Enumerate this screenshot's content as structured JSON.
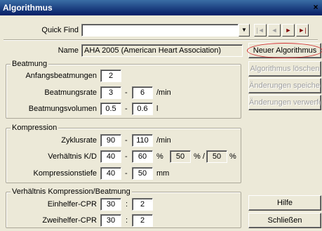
{
  "window": {
    "title": "Algorithmus",
    "close_glyph": "×"
  },
  "quick_find": {
    "label": "Quick Find",
    "value": ""
  },
  "nav": {
    "first": "|◄",
    "prev": "◄",
    "next": "►",
    "last": "►|"
  },
  "name": {
    "label": "Name",
    "value": "AHA 2005 (American Heart Association)"
  },
  "beatmung": {
    "title": "Beatmung",
    "anfangsbeatmungen": {
      "label": "Anfangsbeatmungen",
      "value": "2"
    },
    "beatmungsrate": {
      "label": "Beatmungsrate",
      "min": "3",
      "max": "6",
      "unit": "/min",
      "dash": "-"
    },
    "beatmungsvolumen": {
      "label": "Beatmungsvolumen",
      "min": "0.5",
      "max": "0.6",
      "unit": "l",
      "dash": "-"
    }
  },
  "kompression": {
    "title": "Kompression",
    "zyklusrate": {
      "label": "Zyklusrate",
      "min": "90",
      "max": "110",
      "unit": "/min",
      "dash": "-"
    },
    "verhaeltnis": {
      "label": "Verhältnis K/D",
      "min": "40",
      "max": "60",
      "unit1": "%",
      "v3": "50",
      "sep": "% /",
      "v4": "50",
      "unit2": "%",
      "dash": "-"
    },
    "tiefe": {
      "label": "Kompressionstiefe",
      "min": "40",
      "max": "50",
      "unit": "mm",
      "dash": "-"
    }
  },
  "ratio": {
    "title": "Verhältnis Kompression/Beatmung",
    "einhelfer": {
      "label": "Einhelfer-CPR",
      "a": "30",
      "b": "2",
      "colon": ":"
    },
    "zweihelfer": {
      "label": "Zweihelfer-CPR",
      "a": "30",
      "b": "2",
      "colon": ":"
    }
  },
  "buttons": {
    "neuer": "Neuer Algorithmus",
    "loeschen": "Algorithmus löschen",
    "speichern": "Änderungen speichern",
    "verwerfen": "Änderungen verwerfen",
    "hilfe": "Hilfe",
    "schliessen": "Schließen"
  },
  "colors": {
    "title_bar": "#0a246a",
    "highlight_ring": "#d03030"
  }
}
